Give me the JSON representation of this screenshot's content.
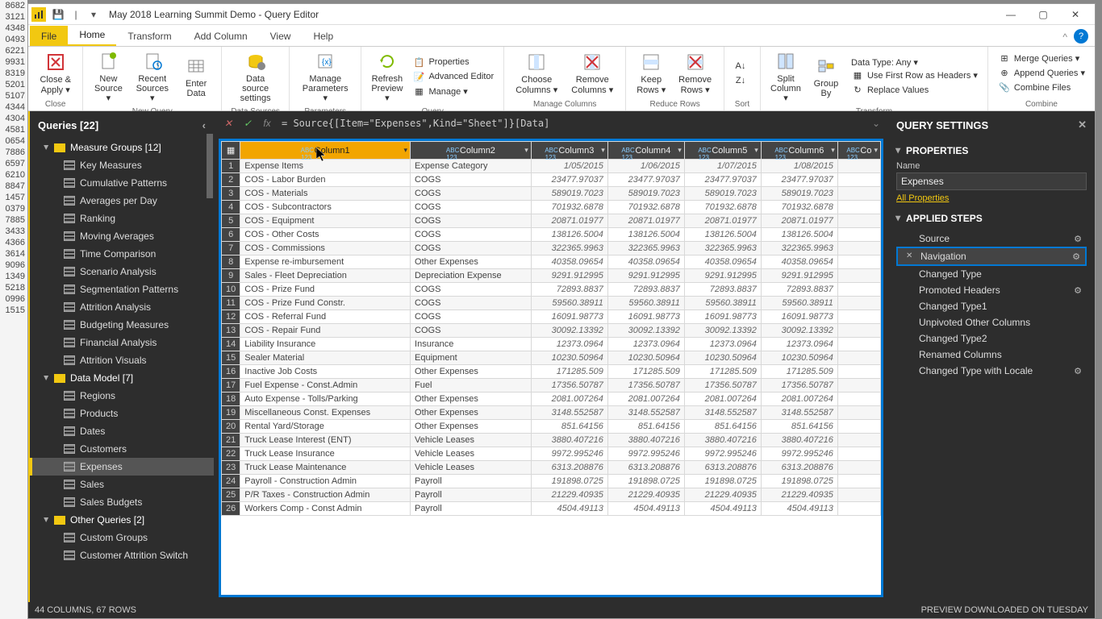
{
  "bg_rows": [
    "8682",
    "3121",
    "4348",
    "0493",
    "6221",
    "9931",
    "8319",
    "5201",
    "5107",
    "4344",
    "4304",
    "4581",
    "0654",
    "7886",
    "6597",
    "6210",
    "8847",
    "1457",
    "0379",
    "7885",
    "3433",
    "4366",
    "3614",
    "9096",
    "1349",
    "5218",
    "0996",
    "1515"
  ],
  "title": "May 2018 Learning Summit Demo - Query Editor",
  "tabs": {
    "file": "File",
    "home": "Home",
    "transform": "Transform",
    "addcol": "Add Column",
    "view": "View",
    "help": "Help"
  },
  "ribbon": {
    "close": {
      "label": "Close",
      "btn": "Close &\nApply ▾"
    },
    "newquery": {
      "label": "New Query",
      "new": "New\nSource ▾",
      "recent": "Recent\nSources ▾",
      "enter": "Enter\nData"
    },
    "datasources": {
      "label": "Data Sources",
      "btn": "Data source\nsettings"
    },
    "parameters": {
      "label": "Parameters",
      "btn": "Manage\nParameters ▾"
    },
    "query": {
      "label": "Query",
      "refresh": "Refresh\nPreview ▾",
      "props": "Properties",
      "adv": "Advanced Editor",
      "manage": "Manage ▾"
    },
    "managecols": {
      "label": "Manage Columns",
      "choose": "Choose\nColumns ▾",
      "remove": "Remove\nColumns ▾"
    },
    "reducerows": {
      "label": "Reduce Rows",
      "keep": "Keep\nRows ▾",
      "remove": "Remove\nRows ▾"
    },
    "sort": {
      "label": "Sort"
    },
    "transform": {
      "label": "Transform",
      "split": "Split\nColumn ▾",
      "group": "Group\nBy",
      "datatype": "Data Type: Any ▾",
      "firstrow": "Use First Row as Headers ▾",
      "replace": "Replace Values"
    },
    "combine": {
      "label": "Combine",
      "merge": "Merge Queries ▾",
      "append": "Append Queries ▾",
      "files": "Combine Files"
    }
  },
  "queries": {
    "title": "Queries [22]",
    "groups": [
      {
        "name": "Measure Groups [12]",
        "items": [
          "Key Measures",
          "Cumulative Patterns",
          "Averages per Day",
          "Ranking",
          "Moving Averages",
          "Time Comparison",
          "Scenario Analysis",
          "Segmentation Patterns",
          "Attrition Analysis",
          "Budgeting Measures",
          "Financial Analysis",
          "Attrition Visuals"
        ]
      },
      {
        "name": "Data Model [7]",
        "items": [
          "Regions",
          "Products",
          "Dates",
          "Customers",
          "Expenses",
          "Sales",
          "Sales Budgets"
        ],
        "selected": "Expenses"
      },
      {
        "name": "Other Queries [2]",
        "items": [
          "Custom Groups",
          "Customer Attrition Switch"
        ]
      }
    ]
  },
  "formula": "= Source{[Item=\"Expenses\",Kind=\"Sheet\"]}[Data]",
  "columns": [
    "Column1",
    "Column2",
    "Column3",
    "Column4",
    "Column5",
    "Column6",
    "Co"
  ],
  "rows": [
    {
      "n": "1",
      "c1": "Expense Items",
      "c2": "Expense Category",
      "v": [
        "1/05/2015",
        "1/06/2015",
        "1/07/2015",
        "1/08/2015"
      ]
    },
    {
      "n": "2",
      "c1": "COS - Labor Burden",
      "c2": "COGS",
      "v": [
        "23477.97037",
        "23477.97037",
        "23477.97037",
        "23477.97037"
      ]
    },
    {
      "n": "3",
      "c1": "COS - Materials",
      "c2": "COGS",
      "v": [
        "589019.7023",
        "589019.7023",
        "589019.7023",
        "589019.7023"
      ]
    },
    {
      "n": "4",
      "c1": "COS - Subcontractors",
      "c2": "COGS",
      "v": [
        "701932.6878",
        "701932.6878",
        "701932.6878",
        "701932.6878"
      ]
    },
    {
      "n": "5",
      "c1": "COS - Equipment",
      "c2": "COGS",
      "v": [
        "20871.01977",
        "20871.01977",
        "20871.01977",
        "20871.01977"
      ]
    },
    {
      "n": "6",
      "c1": "COS - Other Costs",
      "c2": "COGS",
      "v": [
        "138126.5004",
        "138126.5004",
        "138126.5004",
        "138126.5004"
      ]
    },
    {
      "n": "7",
      "c1": "COS - Commissions",
      "c2": "COGS",
      "v": [
        "322365.9963",
        "322365.9963",
        "322365.9963",
        "322365.9963"
      ]
    },
    {
      "n": "8",
      "c1": "Expense re-imbursement",
      "c2": "Other Expenses",
      "v": [
        "40358.09654",
        "40358.09654",
        "40358.09654",
        "40358.09654"
      ]
    },
    {
      "n": "9",
      "c1": "Sales - Fleet Depreciation",
      "c2": "Depreciation Expense",
      "v": [
        "9291.912995",
        "9291.912995",
        "9291.912995",
        "9291.912995"
      ]
    },
    {
      "n": "10",
      "c1": "COS - Prize Fund",
      "c2": "COGS",
      "v": [
        "72893.8837",
        "72893.8837",
        "72893.8837",
        "72893.8837"
      ]
    },
    {
      "n": "11",
      "c1": "COS - Prize Fund Constr.",
      "c2": "COGS",
      "v": [
        "59560.38911",
        "59560.38911",
        "59560.38911",
        "59560.38911"
      ]
    },
    {
      "n": "12",
      "c1": "COS - Referral Fund",
      "c2": "COGS",
      "v": [
        "16091.98773",
        "16091.98773",
        "16091.98773",
        "16091.98773"
      ]
    },
    {
      "n": "13",
      "c1": "COS - Repair Fund",
      "c2": "COGS",
      "v": [
        "30092.13392",
        "30092.13392",
        "30092.13392",
        "30092.13392"
      ]
    },
    {
      "n": "14",
      "c1": "Liability Insurance",
      "c2": "Insurance",
      "v": [
        "12373.0964",
        "12373.0964",
        "12373.0964",
        "12373.0964"
      ]
    },
    {
      "n": "15",
      "c1": "Sealer Material",
      "c2": "Equipment",
      "v": [
        "10230.50964",
        "10230.50964",
        "10230.50964",
        "10230.50964"
      ]
    },
    {
      "n": "16",
      "c1": "Inactive Job Costs",
      "c2": "Other Expenses",
      "v": [
        "171285.509",
        "171285.509",
        "171285.509",
        "171285.509"
      ]
    },
    {
      "n": "17",
      "c1": "Fuel Expense - Const.Admin",
      "c2": "Fuel",
      "v": [
        "17356.50787",
        "17356.50787",
        "17356.50787",
        "17356.50787"
      ]
    },
    {
      "n": "18",
      "c1": "Auto Expense - Tolls/Parking",
      "c2": "Other Expenses",
      "v": [
        "2081.007264",
        "2081.007264",
        "2081.007264",
        "2081.007264"
      ]
    },
    {
      "n": "19",
      "c1": "Miscellaneous Const. Expenses",
      "c2": "Other Expenses",
      "v": [
        "3148.552587",
        "3148.552587",
        "3148.552587",
        "3148.552587"
      ]
    },
    {
      "n": "20",
      "c1": "Rental Yard/Storage",
      "c2": "Other Expenses",
      "v": [
        "851.64156",
        "851.64156",
        "851.64156",
        "851.64156"
      ]
    },
    {
      "n": "21",
      "c1": "Truck Lease Interest (ENT)",
      "c2": "Vehicle Leases",
      "v": [
        "3880.407216",
        "3880.407216",
        "3880.407216",
        "3880.407216"
      ]
    },
    {
      "n": "22",
      "c1": "Truck Lease Insurance",
      "c2": "Vehicle Leases",
      "v": [
        "9972.995246",
        "9972.995246",
        "9972.995246",
        "9972.995246"
      ]
    },
    {
      "n": "23",
      "c1": "Truck Lease Maintenance",
      "c2": "Vehicle Leases",
      "v": [
        "6313.208876",
        "6313.208876",
        "6313.208876",
        "6313.208876"
      ]
    },
    {
      "n": "24",
      "c1": "Payroll - Construction Admin",
      "c2": "Payroll",
      "v": [
        "191898.0725",
        "191898.0725",
        "191898.0725",
        "191898.0725"
      ]
    },
    {
      "n": "25",
      "c1": "P/R Taxes - Construction Admin",
      "c2": "Payroll",
      "v": [
        "21229.40935",
        "21229.40935",
        "21229.40935",
        "21229.40935"
      ]
    },
    {
      "n": "26",
      "c1": "Workers Comp - Const Admin",
      "c2": "Payroll",
      "v": [
        "4504.49113",
        "4504.49113",
        "4504.49113",
        "4504.49113"
      ]
    }
  ],
  "settings": {
    "title": "QUERY SETTINGS",
    "properties": "PROPERTIES",
    "name_label": "Name",
    "name_value": "Expenses",
    "allprops": "All Properties",
    "applied": "APPLIED STEPS",
    "steps": [
      {
        "name": "Source",
        "gear": true
      },
      {
        "name": "Navigation",
        "gear": true,
        "sel": true,
        "x": true
      },
      {
        "name": "Changed Type"
      },
      {
        "name": "Promoted Headers",
        "gear": true
      },
      {
        "name": "Changed Type1"
      },
      {
        "name": "Unpivoted Other Columns"
      },
      {
        "name": "Changed Type2"
      },
      {
        "name": "Renamed Columns"
      },
      {
        "name": "Changed Type with Locale",
        "gear": true
      }
    ]
  },
  "status": {
    "left": "44 COLUMNS, 67 ROWS",
    "right": "PREVIEW DOWNLOADED ON TUESDAY"
  }
}
